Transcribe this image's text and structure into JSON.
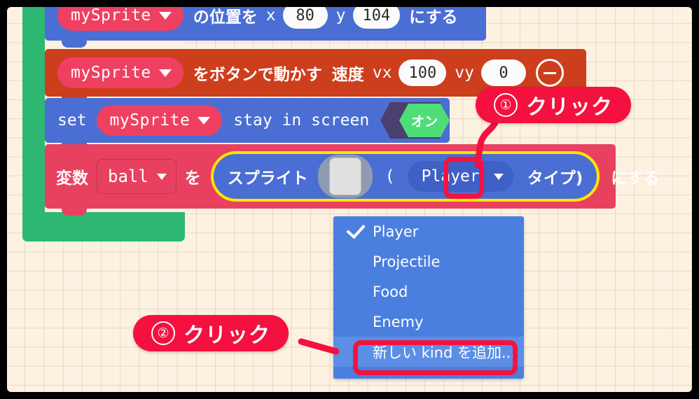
{
  "workspace": {
    "background_color": "#fdf2e1",
    "grid_color": "#d6c4aa",
    "container_block": {
      "name": "on-start-container",
      "color": "#2eb872"
    }
  },
  "blocks": [
    {
      "id": "set-position",
      "color": "#4a6ed3",
      "sprite_dropdown": "mySprite",
      "text_before_x": "の位置を",
      "x_label": "x",
      "x_value": "80",
      "y_label": "y",
      "y_value": "104",
      "suffix": "にする"
    },
    {
      "id": "move-with-buttons",
      "color": "#cd3e1d",
      "sprite_dropdown": "mySprite",
      "text": "をボタンで動かす",
      "speed_label": "速度",
      "vx_label": "vx",
      "vx_value": "100",
      "vy_label": "vy",
      "vy_value": "0",
      "minus_icon": "minus-circle-icon"
    },
    {
      "id": "set-stay-in-screen",
      "color": "#4a6ed3",
      "prefix": "set",
      "sprite_dropdown": "mySprite",
      "text": "stay in screen",
      "toggle_value": "オン",
      "toggle_on_color": "#4ede78",
      "toggle_track_color": "#4b3f6e"
    },
    {
      "id": "set-variable-sprite",
      "color": "#e8415f",
      "prefix": "変数",
      "variable_name": "ball",
      "particle": "を",
      "reporter": {
        "label": "スプライト",
        "thumbnail": "sprite-thumbnail",
        "paren_open": "(",
        "kind_dropdown": "Player",
        "kind_suffix": "タイプ)",
        "highlight_color": "#ffe500"
      },
      "suffix": "にする"
    }
  ],
  "dropdown_menu": {
    "name": "kind-dropdown-menu",
    "background_color": "#4a7fe0",
    "items": [
      {
        "label": "Player",
        "checked": true,
        "highlighted": false
      },
      {
        "label": "Projectile",
        "checked": false,
        "highlighted": false
      },
      {
        "label": "Food",
        "checked": false,
        "highlighted": false
      },
      {
        "label": "Enemy",
        "checked": false,
        "highlighted": false
      },
      {
        "label": "新しい kind を追加...",
        "checked": false,
        "highlighted": true
      }
    ]
  },
  "annotations": {
    "color": "#f4103f",
    "callouts": [
      {
        "id": "callout-1",
        "number": "①",
        "text": "クリック",
        "target": "kind-dropdown-caret"
      },
      {
        "id": "callout-2",
        "number": "②",
        "text": "クリック",
        "target": "menu-item-add-new-kind"
      }
    ],
    "highlight_boxes": [
      {
        "id": "highlight-kind-caret",
        "color": "#f4133f"
      },
      {
        "id": "highlight-add-new-kind",
        "color": "#f4133f"
      }
    ]
  }
}
